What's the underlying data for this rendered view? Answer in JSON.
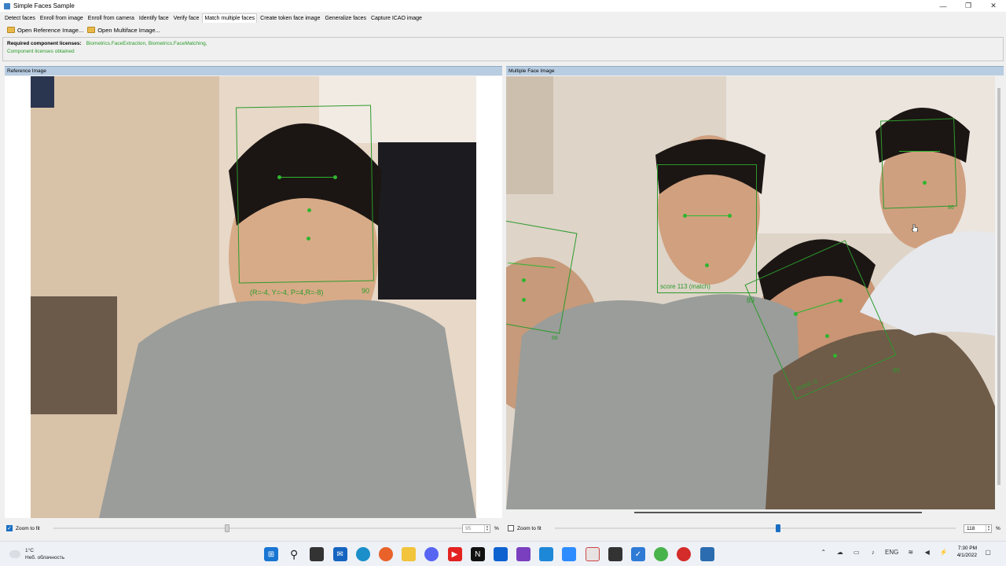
{
  "window": {
    "title": "Simple Faces Sample",
    "controls": [
      "—",
      "❐",
      "✕"
    ]
  },
  "tabs": [
    {
      "label": "Detect faces"
    },
    {
      "label": "Enroll from image"
    },
    {
      "label": "Enroll from camera"
    },
    {
      "label": "Identify face"
    },
    {
      "label": "Verify face"
    },
    {
      "label": "Match multiple faces"
    },
    {
      "label": "Create token face image"
    },
    {
      "label": "Generalize faces"
    },
    {
      "label": "Capture ICAO image"
    }
  ],
  "toolbar": {
    "open_reference": "Open Reference Image...",
    "open_multiface": "Open Multiface Image..."
  },
  "licenses": {
    "label": "Required component licenses:",
    "components": "Biometrics.FaceExtraction, Biometrics.FaceMatching,",
    "status": "Component licenses obtained"
  },
  "reference_panel": {
    "header": "Reference Image",
    "face_label": "(R=-4, Y=-4, P=4,R=-8)",
    "quality": "90"
  },
  "multi_panel": {
    "header": "Multiple Face Image",
    "faces": [
      {
        "score": "score 113 (match)",
        "quality": "89"
      },
      {
        "score": "score: 0",
        "quality": "85"
      },
      {
        "score": "score: 0",
        "quality": "88"
      },
      {
        "score": "",
        "quality": "86"
      }
    ]
  },
  "left_zoom": {
    "label": "Zoom to fit",
    "checked": true,
    "value": "95",
    "unit": "%",
    "slider_level": 0.42
  },
  "right_zoom": {
    "label": "Zoom to fit",
    "checked": false,
    "value": "118",
    "unit": "%",
    "slider_level": 0.55
  },
  "taskbar": {
    "temp": "1°C",
    "weather": "Неб. облачность",
    "lang": "ENG",
    "time": "7:30 PM",
    "date": "4/1/2022",
    "apps": [
      "windows-start",
      "search",
      "task-view",
      "mail",
      "edge",
      "firefox",
      "file-explorer",
      "discord",
      "youtube",
      "notion",
      "dropbox",
      "visual-studio",
      "vscode",
      "zoom",
      "clipboard",
      "todo",
      "chrome-canary",
      "app-red",
      "active-app"
    ]
  }
}
